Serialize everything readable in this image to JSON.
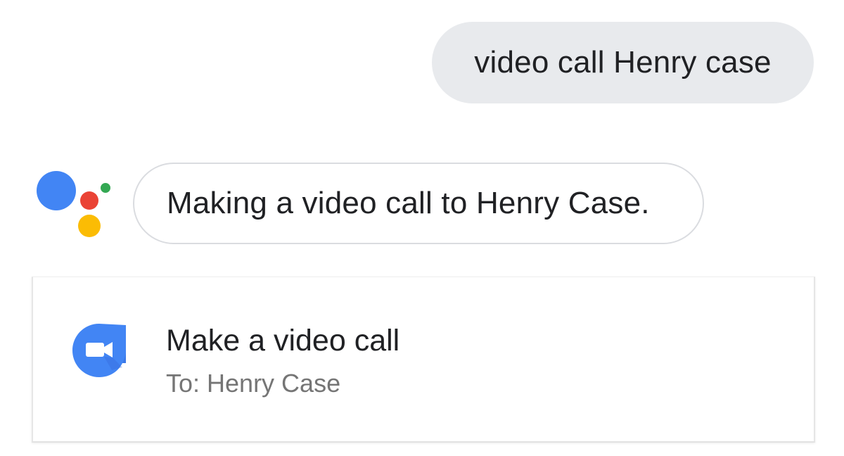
{
  "user_query": {
    "text": "video call Henry case"
  },
  "assistant": {
    "logo_icon": "google-assistant-icon",
    "response_text": "Making a video call to Henry Case.",
    "colors": {
      "blue": "#4285f4",
      "red": "#ea4335",
      "yellow": "#fbbc04",
      "green": "#34a853"
    }
  },
  "action_card": {
    "icon": "duo-video-camera-icon",
    "title": "Make a video call",
    "subtitle": "To: Henry Case",
    "icon_color": "#4285f4"
  }
}
